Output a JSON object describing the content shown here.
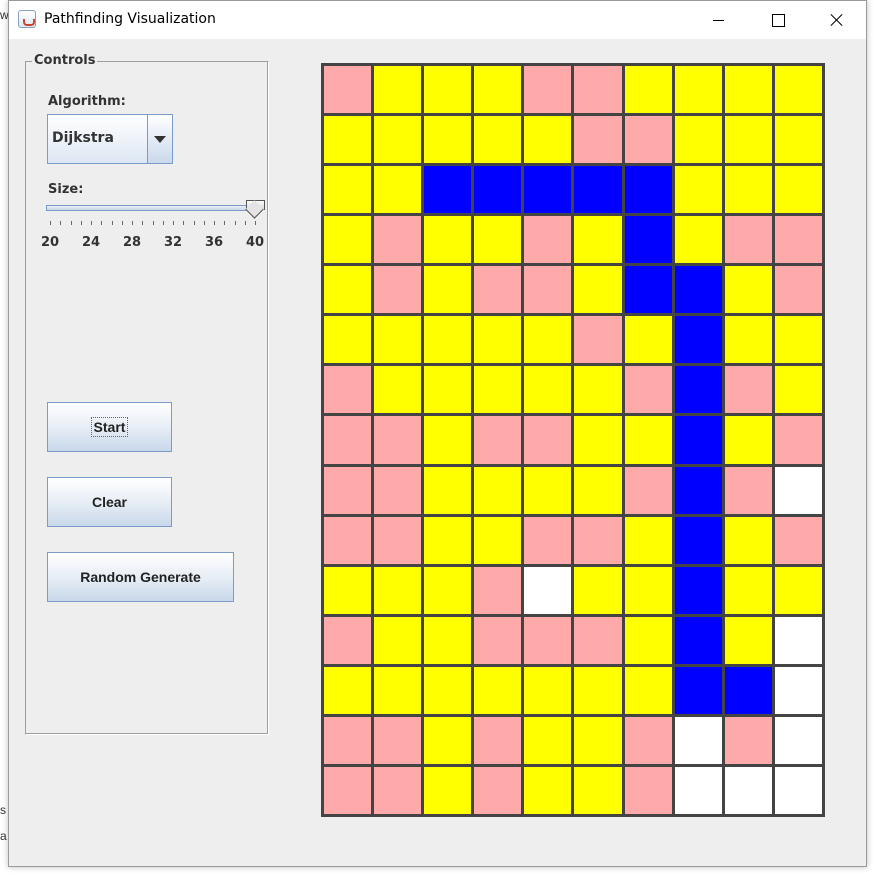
{
  "window": {
    "title": "Pathfinding Visualization",
    "icon": "java-cup-icon"
  },
  "background": {
    "fragment_top": "w",
    "fragment_s": "s",
    "fragment_a": "a"
  },
  "controls": {
    "group_title": "Controls",
    "algorithm_label": "Algorithm:",
    "algorithm_value": "Dijkstra",
    "size_label": "Size:",
    "size_min": 20,
    "size_max": 40,
    "size_value": 40,
    "size_ticks": [
      "20",
      "24",
      "28",
      "32",
      "36",
      "40"
    ],
    "start_label": "Start",
    "clear_label": "Clear",
    "random_label": "Random Generate"
  },
  "grid": {
    "columns": 10,
    "rows": 15,
    "legend": {
      "Y": "#ffff00",
      "P": "#ffaaaa",
      "B": "#0000ff",
      "W": "#ffffff"
    },
    "border_color": "#444444",
    "cells": [
      "PYYYPPYYYY",
      "YYYYYPPYYY",
      "YYBBBBBYYY",
      "YPYYPYBYPP",
      "YPYPPYBBYP",
      "YYYYYPYBYY",
      "PYYYYYPBPY",
      "PPYPPYYBYP",
      "PPYYYYPBPW",
      "PPYYPPYBYP",
      "YYYPWYYBYY",
      "PYYPPPYBYW",
      "YYYYYYYBBW",
      "PPYPYYPWPW",
      "PPYPYYPWWW"
    ]
  }
}
